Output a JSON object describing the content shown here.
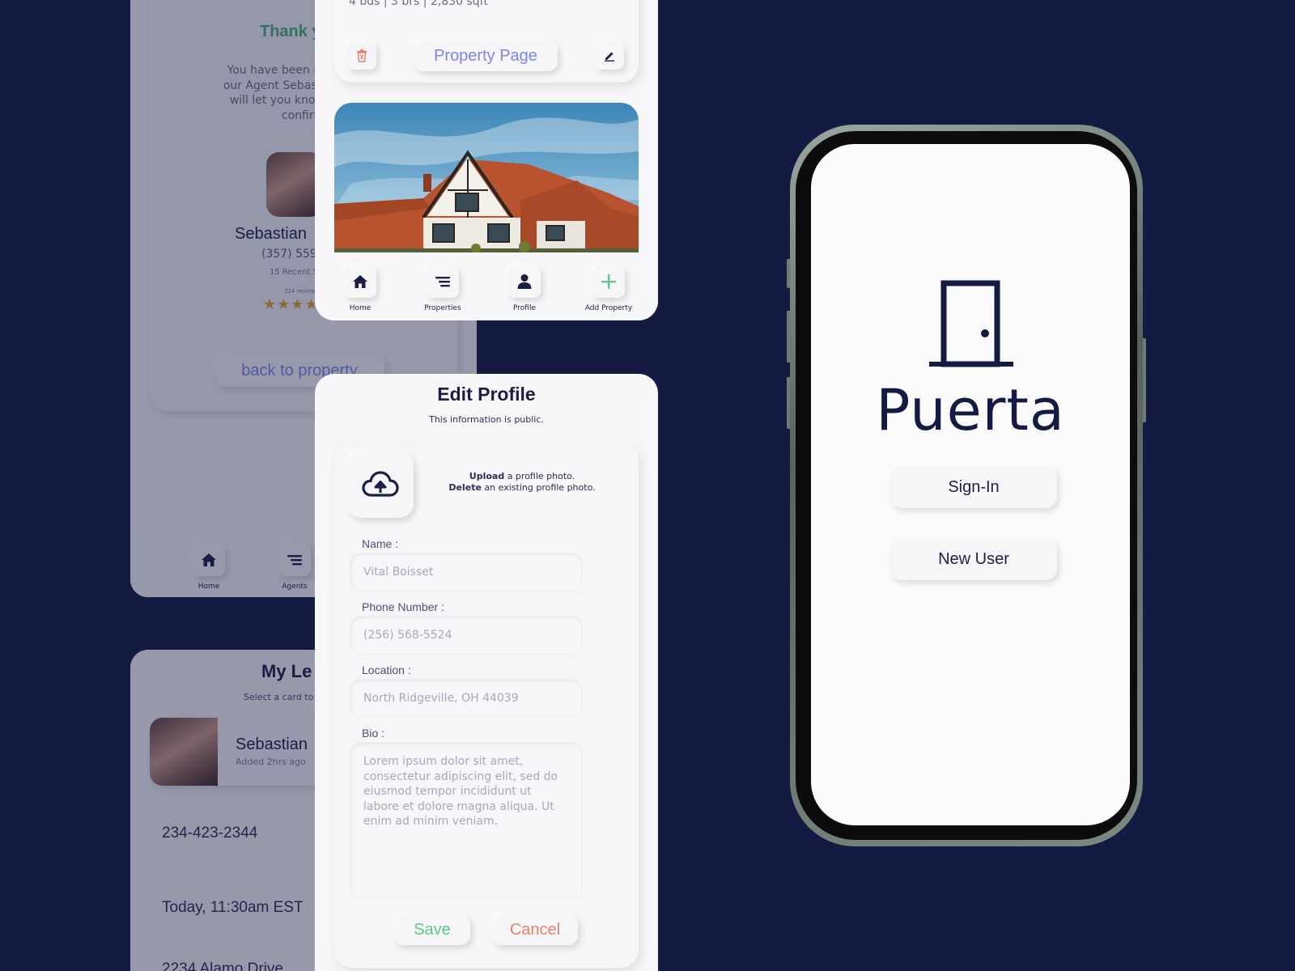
{
  "confirmation_card": {
    "thank_you": "Thank y",
    "message_lines": [
      "You have been m",
      "our Agent Sebasti",
      "will let you know",
      "confirm"
    ],
    "agent_name": "Sebastian",
    "agent_phone": "(357) 559-",
    "recent_sales": "15 Recent S",
    "reviews": "324 review",
    "rating_stars": 4,
    "back_link": "back to property",
    "nav": [
      {
        "label": "Home",
        "icon": "home-icon"
      },
      {
        "label": "Agents",
        "icon": "list-icon"
      }
    ]
  },
  "leads_card": {
    "title": "My Le",
    "subtitle": "Select a card to v",
    "lead_name": "Sebastian",
    "lead_added": "Added 2hrs ago",
    "phone": "234-423-2344",
    "time": "Today, 11:30am EST",
    "address": "2234 Alamo Drive"
  },
  "property_card": {
    "specs": "4 bds | 3 brs | 2,830 sqft",
    "page_button": "Property Page",
    "nav": [
      {
        "label": "Home",
        "icon": "home-icon"
      },
      {
        "label": "Properties",
        "icon": "list-icon"
      },
      {
        "label": "Profile",
        "icon": "person-icon"
      },
      {
        "label": "Add Property",
        "icon": "plus-icon"
      }
    ]
  },
  "edit_profile": {
    "title": "Edit Profile",
    "subtitle": "This information is public.",
    "upload_bold": "Upload",
    "upload_rest": " a profile photo.",
    "delete_bold": "Delete",
    "delete_rest": " an existing profile photo.",
    "name_label": "Name :",
    "name_placeholder": "Vital Boisset",
    "phone_label": "Phone Number :",
    "phone_placeholder": "(256) 568-5524",
    "location_label": "Location :",
    "location_placeholder": "North Ridgeville, OH 44039",
    "bio_label": "Bio :",
    "bio_placeholder": "Lorem ipsum dolor sit amet, consectetur adipiscing elit, sed do eiusmod tempor incididunt ut labore et dolore magna aliqua. Ut enim ad minim veniam.",
    "save_label": "Save",
    "cancel_label": "Cancel"
  },
  "phone_app": {
    "brand": "Puerta",
    "signin_label": "Sign-In",
    "newuser_label": "New User"
  },
  "colors": {
    "background": "#151a42",
    "navy": "#1b1f44",
    "accent_blue": "#7c86e8",
    "accent_green": "#5cc98a",
    "accent_red": "#ef7e6e",
    "star": "#e0a23a"
  }
}
